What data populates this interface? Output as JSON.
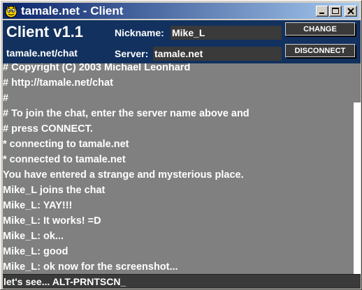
{
  "window": {
    "title": "tamale.net - Client",
    "icon": "tamale-logo-icon",
    "buttons": {
      "minimize": "minimize-icon",
      "maximize": "maximize-icon",
      "close": "close-icon"
    },
    "titlebar_colors": [
      "#0a246a",
      "#a6caf0"
    ]
  },
  "header": {
    "brand": "Client v1.1",
    "subtitle": "tamale.net/chat",
    "nickname_label": "Nickname:",
    "nickname_value": "Mike_L",
    "server_label": "Server:",
    "server_value": "tamale.net",
    "change_label": "CHANGE",
    "disconnect_label": "DISCONNECT",
    "background": "#12315e"
  },
  "transcript": {
    "lines": [
      "# Copyright (C) 2003 Michael Leonhard",
      "# http://tamale.net/chat",
      "#",
      "# To join the chat, enter the server name above and",
      "# press CONNECT.",
      "* connecting to tamale.net",
      "* connected to tamale.net",
      "You have entered a strange and mysterious place.",
      "Mike_L joins the chat",
      "Mike_L: YAY!!!",
      "Mike_L: It works! =D",
      "Mike_L: ok...",
      "Mike_L: good",
      "Mike_L: ok now for the screenshot..."
    ],
    "background": "#808080"
  },
  "message_input": {
    "value": "let's see... ALT-PRNTSCN_"
  }
}
